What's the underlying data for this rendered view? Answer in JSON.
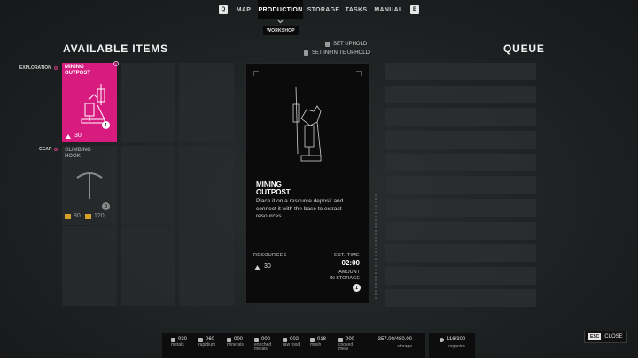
{
  "nav": {
    "left_key": "Q",
    "right_key": "E",
    "tabs": [
      "MAP",
      "PRODUCTION",
      "STORAGE",
      "TASKS",
      "MANUAL"
    ],
    "active_tab": "PRODUCTION",
    "subtab": "WORKSHOP"
  },
  "available": {
    "title": "AVAILABLE ITEMS",
    "set_uphold": "SET UPHOLD",
    "set_infinite_uphold": "SET INFINITE UPHOLD",
    "categories": [
      {
        "label": "EXPLORATION",
        "item": {
          "name": "MINING\nOUTPOST",
          "cost": "30",
          "count": "1"
        }
      },
      {
        "label": "GEAR",
        "item": {
          "name": "CLIMBING\nHOOK",
          "cost_a": "80",
          "cost_b": "120",
          "count": "0"
        }
      }
    ]
  },
  "details": {
    "title": "MINING\nOUTPOST",
    "description": "Place it on a resource deposit and connect it with the base to extract resources.",
    "resources_label": "RESOURCES",
    "resources_value": "30",
    "est_time_label": "EST. TIME",
    "est_time_value": "02:00",
    "amount_label": "AMOUNT\nIN STORAGE",
    "amount_value": "1"
  },
  "queue": {
    "title": "QUEUE"
  },
  "resources": [
    {
      "value": "030",
      "name": "metals"
    },
    {
      "value": "060",
      "name": "rapidium"
    },
    {
      "value": "000",
      "name": "minerals"
    },
    {
      "value": "000",
      "name": "enriched\nmetals"
    },
    {
      "value": "002",
      "name": "raw food"
    },
    {
      "value": "018",
      "name": "mush"
    },
    {
      "value": "000",
      "name": "cooked\nmeal"
    }
  ],
  "storage": {
    "value": "357.00/480.00",
    "label": "storage"
  },
  "organics": {
    "value": "116/300",
    "label": "organics"
  },
  "close": {
    "key": "ESC",
    "label": "CLOSE"
  },
  "colors": {
    "accent": "#d81b7f",
    "gold": "#d6a12a"
  }
}
